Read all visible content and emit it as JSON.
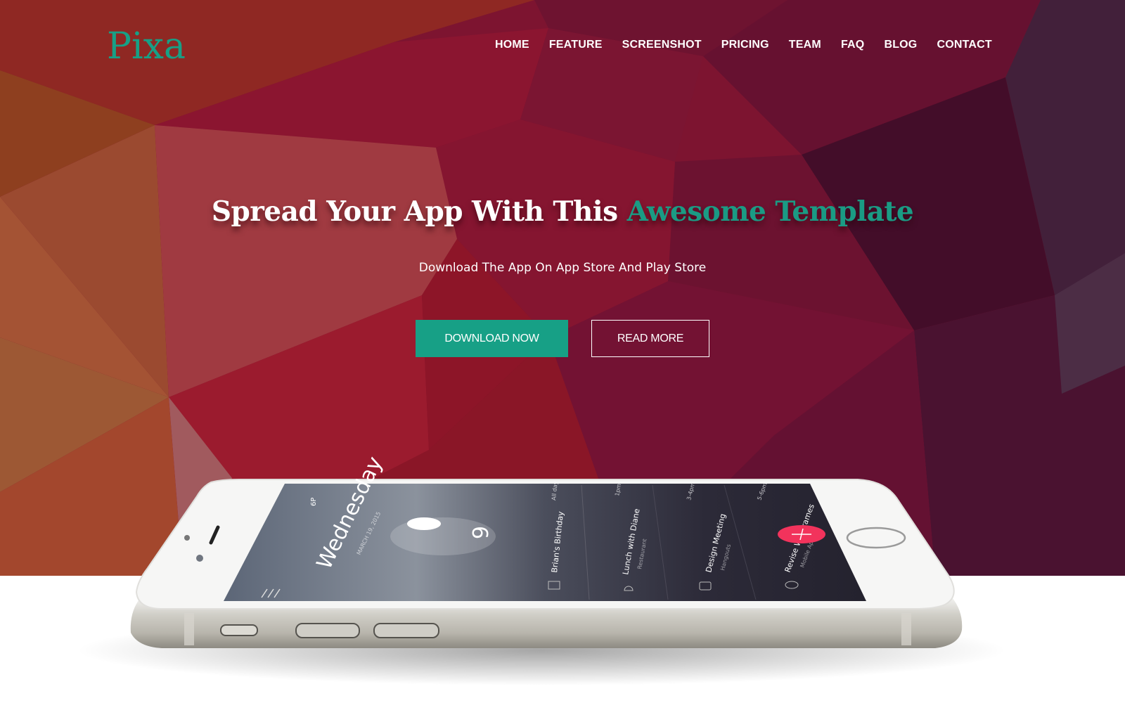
{
  "brand": {
    "name": "Pixa",
    "accent_color": "#17a086"
  },
  "nav": {
    "items": [
      {
        "label": "HOME"
      },
      {
        "label": "FEATURE"
      },
      {
        "label": "SCREENSHOT"
      },
      {
        "label": "PRICING"
      },
      {
        "label": "TEAM"
      },
      {
        "label": "FAQ"
      },
      {
        "label": "BLOG"
      },
      {
        "label": "CONTACT"
      }
    ]
  },
  "hero": {
    "headline_main": "Spread Your App With This",
    "headline_accent": "Awesome Template",
    "subheadline": "Download The App On App Store And Play Store",
    "primary_button": "DOWNLOAD NOW",
    "secondary_button": "READ MORE",
    "background_color": "#7d1430"
  },
  "phone_screen": {
    "day": "Wednesday",
    "date": "MARCH 19, 2015",
    "count": "6",
    "count_badge": "⊙",
    "status_text": "6P",
    "events": [
      {
        "title": "Brian's Birthday",
        "subtitle": "",
        "time": "All day"
      },
      {
        "title": "Lunch with Diane",
        "subtitle": "Restaurant",
        "time": "1pm"
      },
      {
        "title": "Design Meeting",
        "subtitle": "Hangouts",
        "time": "3-4pm"
      },
      {
        "title": "Revise Wireframes",
        "subtitle": "Mobile App",
        "time": "5-6pm"
      }
    ],
    "fab_color": "#f2335c",
    "fab_icon": "+"
  }
}
